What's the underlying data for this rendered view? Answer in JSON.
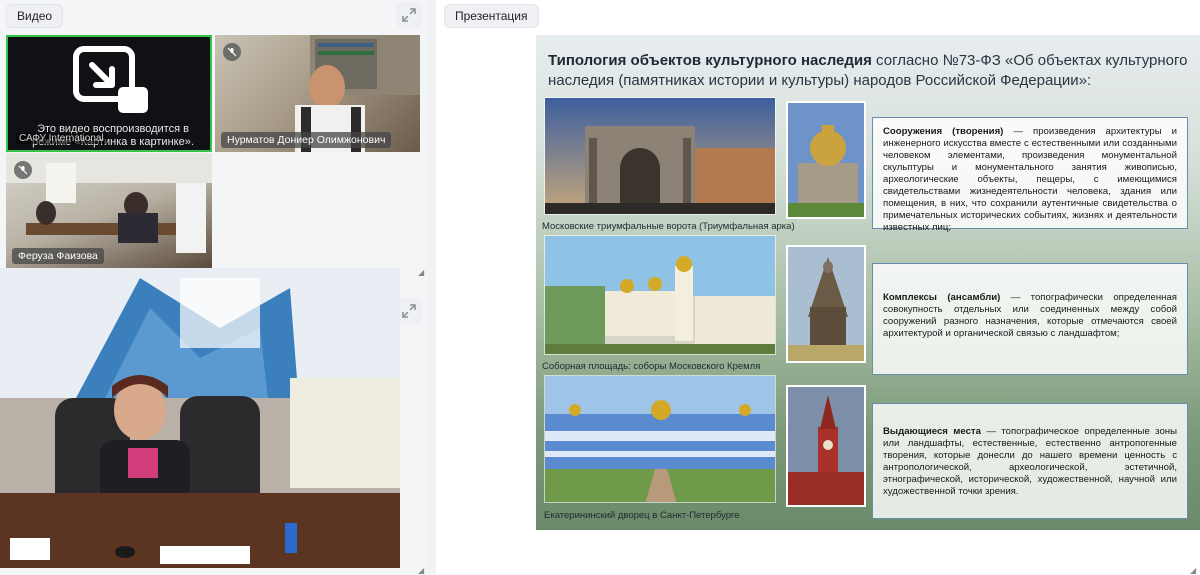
{
  "video_panel": {
    "title": "Видео",
    "participants": [
      {
        "pip_message": "Это видео воспроизводится в режиме «Картинка в картинке».",
        "org_label": "САФУ International"
      },
      {
        "name": "Нурматов Дониер Олимжонович"
      },
      {
        "name": "Феруза Фаизова"
      }
    ]
  },
  "presentation_panel": {
    "title": "Презентация",
    "slide": {
      "title_bold": "Типология объектов культурного наследия",
      "title_rest": " согласно №73-ФЗ «Об объектах культурного наследия (памятниках истории и культуры) народов Российской Федерации»:",
      "rows": [
        {
          "caption": "Московские триумфальные ворота (Триумфальная арка)",
          "term": "Сооружения (творения)",
          "text": " — произведения архитектуры и инженерного искусства вместе с естественными или созданными человеком элементами, произведения монументальной скульптуры и монументального занятия живописью, археологические объекты, пещеры, с имеющимися свидетельствами жизнедеятельности человека, здания или помещения, в них, что сохранили аутентичные свидетельства о примечательных исторических событиях, жизнях и деятельности известных лиц;"
        },
        {
          "caption": "Соборная площадь: соборы Московского Кремля",
          "term": "Комплексы (ансамбли)",
          "text": " — топографически определенная совокупность отдельных или соединенных между собой сооружений разного назначения, которые отмечаются своей архитектурой и органической связью с ландшафтом;"
        },
        {
          "caption": "Екатерининский дворец в Санкт-Петербурге",
          "term": "Выдающиеся места",
          "text": " — топографическое определенные зоны или ландшафты, естественные, естественно антропогенные творения, которые донесли до нашего времени ценность с антропологической, археологической, эстетичной, этнографической, исторической, художественной, научной или художественной точки зрения."
        }
      ]
    }
  },
  "colors": {
    "active_speaker_border": "#33c44a",
    "desc_border": "#6a8cae"
  }
}
